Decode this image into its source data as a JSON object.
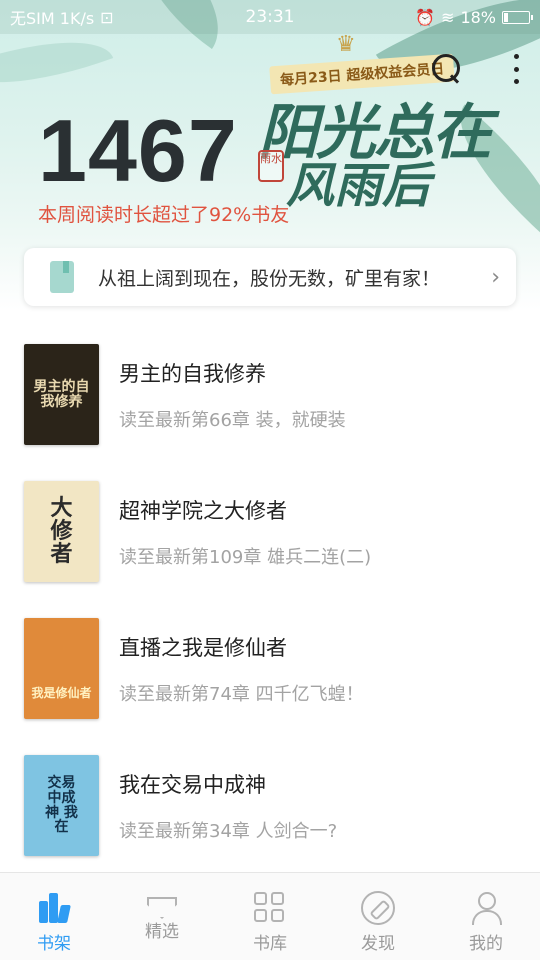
{
  "status_bar": {
    "carrier": "无SIM 1K/s",
    "time": "23:31",
    "battery": "18%",
    "battery_level": 0.18
  },
  "header": {
    "reading_minutes": "1467",
    "reading_subtitle": "本周阅读时长超过了92%书友",
    "promo": {
      "badge": "每月23日 超级权益会员日",
      "title_line1": "阳光总在",
      "title_line2": "风雨后",
      "seal": "雨水"
    }
  },
  "notice": {
    "text": "从祖上阔到现在，股份无数，矿里有家！"
  },
  "books": [
    {
      "title": "男主的自我修养",
      "progress": "读至最新第66章 装，就硬装",
      "cover_text": "男主的自我修养",
      "cover_bg": "#2b2419",
      "cover_fg": "#e9d9b0"
    },
    {
      "title": "超神学院之大修者",
      "progress": "读至最新第109章 雄兵二连(二)",
      "cover_text": "大修者",
      "cover_bg": "#f2e6c4",
      "cover_fg": "#2b2b2b"
    },
    {
      "title": "直播之我是修仙者",
      "progress": "读至最新第74章 四千亿飞蝗！",
      "cover_text": "我是修仙者",
      "cover_bg": "#e08a3a",
      "cover_fg": "#fff1c0"
    },
    {
      "title": "我在交易中成神",
      "progress": "读至最新第34章 人剑合一?",
      "cover_text": "交易中成神 我在",
      "cover_bg": "#7fc4e2",
      "cover_fg": "#12314a"
    }
  ],
  "bottom_nav": [
    {
      "label": "书架",
      "icon": "bookshelf-icon",
      "active": true
    },
    {
      "label": "精选",
      "icon": "diamond-icon",
      "active": false
    },
    {
      "label": "书库",
      "icon": "grid-icon",
      "active": false
    },
    {
      "label": "发现",
      "icon": "compass-icon",
      "active": false
    },
    {
      "label": "我的",
      "icon": "profile-icon",
      "active": false
    }
  ],
  "colors": {
    "accent": "#2f9cf3",
    "highlight_text": "#e0533f"
  }
}
